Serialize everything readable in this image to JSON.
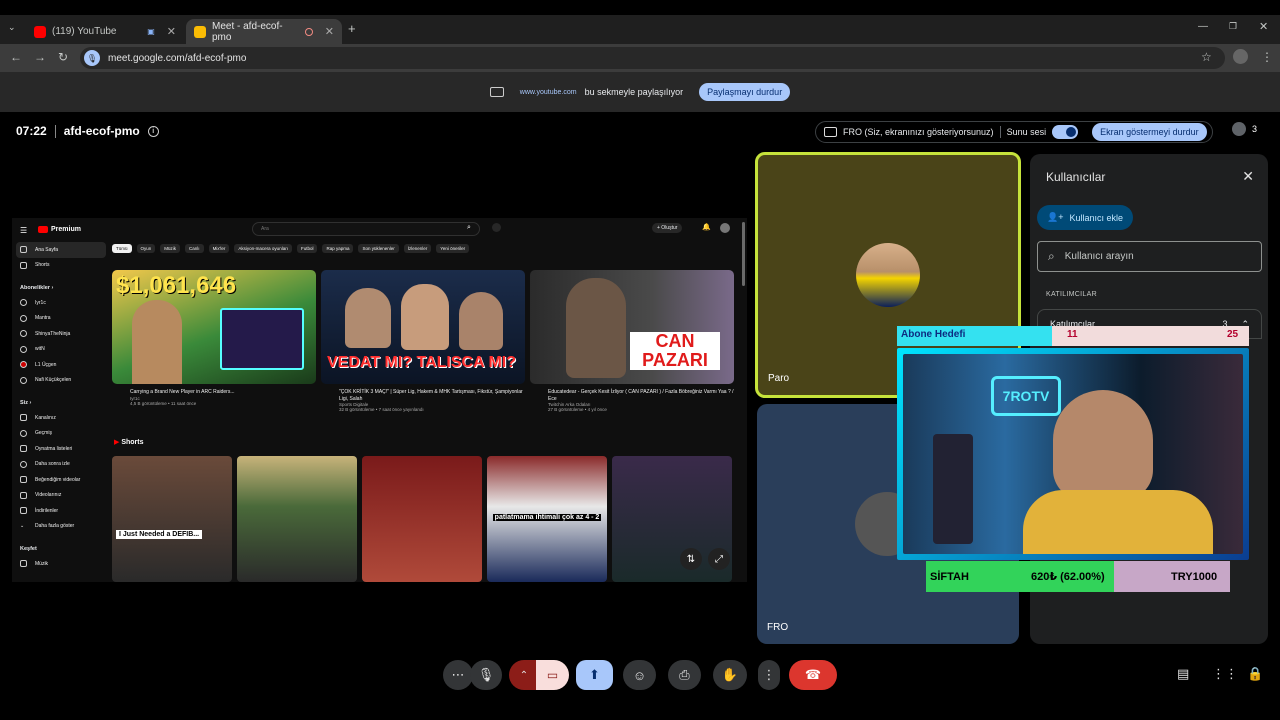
{
  "browser": {
    "tabs": [
      {
        "title": "(119) YouTube",
        "active": false
      },
      {
        "title": "Meet - afd-ecof-pmo",
        "active": true
      }
    ],
    "url": "meet.google.com/afd-ecof-pmo"
  },
  "sharebar": {
    "site": "www.youtube.com",
    "text": "bu sekmeyle paylaşılıyor",
    "stop": "Paylaşmayı durdur"
  },
  "meeting": {
    "time": "07:22",
    "code": "afd-ecof-pmo",
    "presenting": "FRO (Siz, ekranınızı gösteriyorsunuz)",
    "sound_label": "Sunu sesi",
    "stop_present": "Ekran göstermeyi durdur",
    "people_count": "3"
  },
  "youtube": {
    "brand": "Premium",
    "search_placeholder": "Ara",
    "create": "+ Oluştur",
    "sidebar": [
      {
        "label": "Ana Sayfa",
        "active": true
      },
      {
        "label": "Shorts"
      }
    ],
    "subs_header": "Abonelikler ›",
    "subs": [
      "Iyr1c",
      "Mantra",
      "ShinyaTheNinja",
      "witN",
      "L1 Üçgen",
      "Nafi Küçükçelen"
    ],
    "you_header": "Siz ›",
    "you_items": [
      "Kanalınız",
      "Geçmiş",
      "Oynatma listeleri",
      "Daha sonra izle",
      "Beğendiğim videolar",
      "Videolarınız",
      "İndirilenler",
      "Daha fazla göster"
    ],
    "explore_header": "Keşfet",
    "explore_items": [
      "Müzik"
    ],
    "chips": [
      "Tümü",
      "Oyun",
      "Müzik",
      "Canlı",
      "Mix'ler",
      "Aksiyon-macera oyunları",
      "Futbol",
      "Rap yapma",
      "Son yüklenenler",
      "İzlenenler",
      "Yeni öneriler"
    ],
    "videos": [
      {
        "thumb_text": "$1,061,646",
        "title": "Carrying a Brand New Player in ARC Raiders...",
        "meta": "4,5 B görüntüleme • 11 saat önce",
        "channel": "Iyr1c"
      },
      {
        "thumb_text": "VEDAT MI? TALISCA MI?",
        "title": "\"ÇOK KRİTİK 3 MAÇ!\" | Süper Lig, Hakem & MHK Tartışması, Fikstür, Şampiyonlar Ligi, Salah",
        "meta": "32 B görüntüleme • 7 saat önce yayınlandı",
        "channel": "Sports Digitale"
      },
      {
        "thumb_text": "CAN PAZARI",
        "title": "Educatedear - Gerçek Kesit İzliyor ( CAN PAZARI ) / Fazla Böbreğiniz Varmı Yaa ? / Ece",
        "meta": "27 B görüntüleme • 4 yıl önce",
        "channel": "Twitchin Arka Odaları"
      }
    ],
    "shorts_title": "Shorts",
    "shorts": [
      "I Just Needed a DEFIB...",
      "",
      "",
      "patlatmama ihtimali çok az 4 - 2",
      ""
    ]
  },
  "tiles": {
    "top_name": "Paro",
    "bottom_name": "FRO"
  },
  "panel": {
    "title": "Kullanıcılar",
    "add_user": "Kullanıcı ekle",
    "search_placeholder": "Kullanıcı arayın",
    "section": "KATILIMCILAR",
    "group_label": "Katılımcılar",
    "group_count": "3"
  },
  "overlay": {
    "goal_label": "Abone Hedefi",
    "goal_current": "11",
    "goal_target": "25",
    "goal_fraction": 0.44,
    "bar_left": "SİFTAH",
    "bar_mid": "620₺ (62.00%)",
    "bar_right": "TRY1000",
    "bar_fraction": 0.62
  },
  "colors": {
    "accent": "#a8c7fa",
    "end_call": "#dc362e",
    "cam_off": "#f9dedc",
    "present_active": "#a8c7fa",
    "tile_highlight": "#c6e33b"
  }
}
